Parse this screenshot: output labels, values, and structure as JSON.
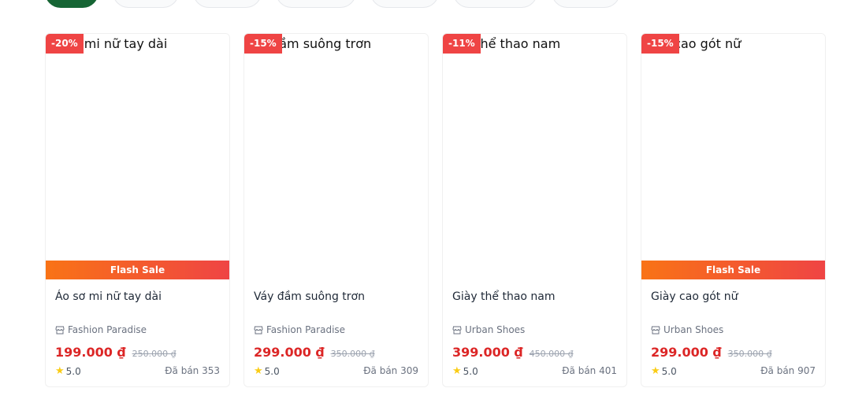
{
  "filter_tabs": [
    {
      "label": "",
      "active": true
    },
    {
      "label": "",
      "active": false
    },
    {
      "label": "",
      "active": false
    },
    {
      "label": "",
      "active": false
    },
    {
      "label": "",
      "active": false
    },
    {
      "label": "",
      "active": false
    },
    {
      "label": "",
      "active": false
    }
  ],
  "products": [
    {
      "image_alt": "Áo sơ mi nữ tay dài",
      "discount": "-20%",
      "flash_sale": "Flash Sale",
      "name": "Áo sơ mi nữ tay dài",
      "shop": "Fashion Paradise",
      "price": "199.000 ₫",
      "old_price": "250.000 ₫",
      "rating": "5.0",
      "sold": "Đã bán 353"
    },
    {
      "image_alt": "Váy đầm suông trơn",
      "discount": "-15%",
      "flash_sale": "",
      "name": "Váy đầm suông trơn",
      "shop": "Fashion Paradise",
      "price": "299.000 ₫",
      "old_price": "350.000 ₫",
      "rating": "5.0",
      "sold": "Đã bán 309"
    },
    {
      "image_alt": "Giày thể thao nam",
      "discount": "-11%",
      "flash_sale": "",
      "name": "Giày thể thao nam",
      "shop": "Urban Shoes",
      "price": "399.000 ₫",
      "old_price": "450.000 ₫",
      "rating": "5.0",
      "sold": "Đã bán 401"
    },
    {
      "image_alt": "Giày cao gót nữ",
      "discount": "-15%",
      "flash_sale": "Flash Sale",
      "name": "Giày cao gót nữ",
      "shop": "Urban Shoes",
      "price": "299.000 ₫",
      "old_price": "350.000 ₫",
      "rating": "5.0",
      "sold": "Đã bán 907"
    }
  ],
  "colors": {
    "accent_green": "#166534",
    "discount_red": "#ef4444",
    "price_red": "#dc2626",
    "star_yellow": "#facc15"
  }
}
